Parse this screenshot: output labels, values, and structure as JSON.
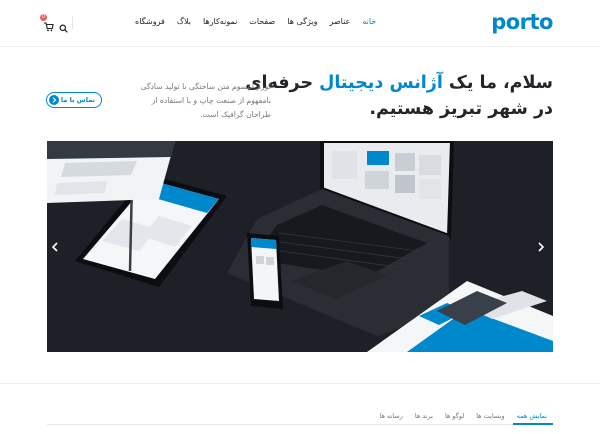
{
  "header": {
    "logo": "porto",
    "nav": [
      {
        "label": "خانه",
        "active": true
      },
      {
        "label": "عناصر",
        "active": false
      },
      {
        "label": "ویژگی ها",
        "active": false
      },
      {
        "label": "صفحات",
        "active": false
      },
      {
        "label": "نمونه‌کارها",
        "active": false
      },
      {
        "label": "بلاگ",
        "active": false
      },
      {
        "label": "فروشگاه",
        "active": false
      }
    ],
    "cart_count": "0"
  },
  "hero_text": {
    "headline_part1": "سلام، ما یک ",
    "headline_accent": "آژانس دیجیتال",
    "headline_part2": " حرفه‌ای در شهر تبریز هستیم.",
    "lead": "لورم ایپسوم متن ساختگی با تولید سادگی نامفهوم از صنعت چاپ و با استفاده از طراحان گرافیک است.",
    "contact_label": "تماس با ما"
  },
  "filters": [
    {
      "label": "نمایش همه",
      "active": true
    },
    {
      "label": "وبسایت ها",
      "active": false
    },
    {
      "label": "لوگو ها",
      "active": false
    },
    {
      "label": "برند ها",
      "active": false
    },
    {
      "label": "رسانه ها",
      "active": false
    }
  ],
  "colors": {
    "accent": "#0088cc",
    "hero_bg": "#1d2127",
    "badge": "#e36159"
  }
}
